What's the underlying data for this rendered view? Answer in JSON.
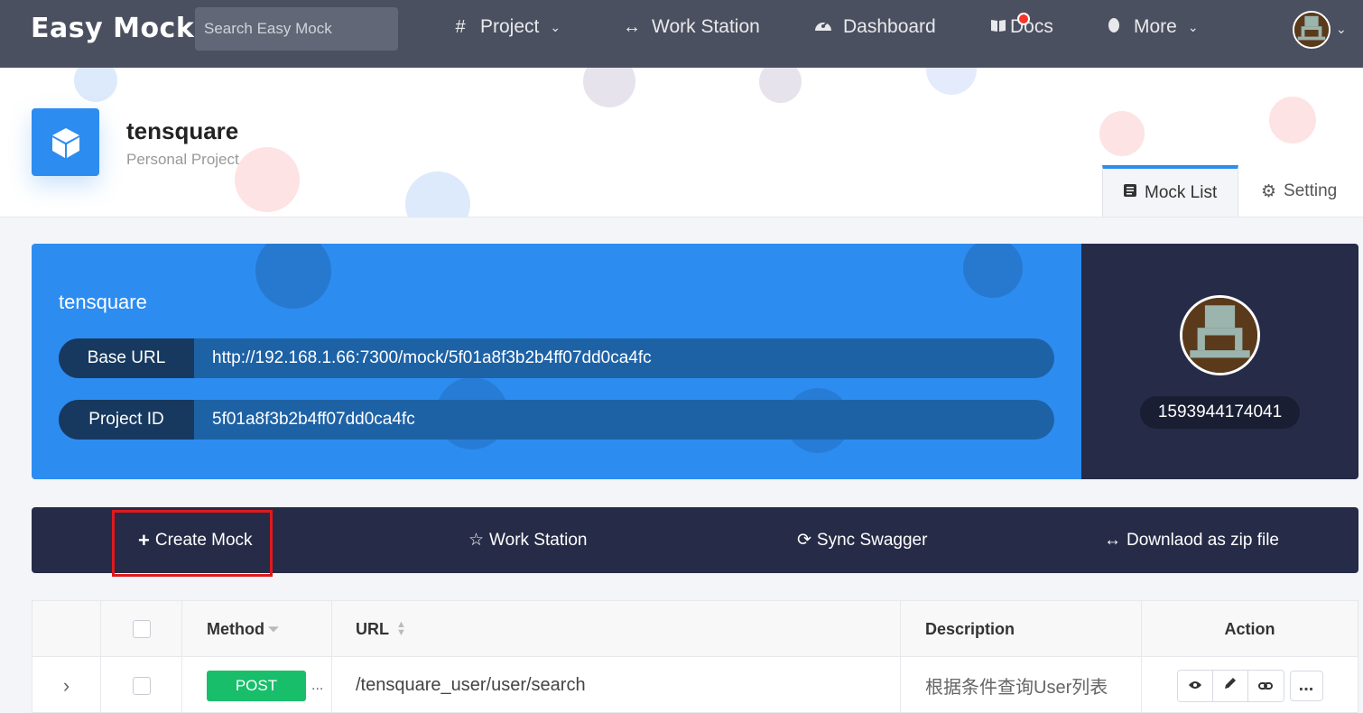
{
  "nav": {
    "logo": "Easy Mock",
    "search_placeholder": "Search Easy Mock",
    "items": [
      {
        "label": "Project",
        "icon": "hash-icon",
        "has_dropdown": true
      },
      {
        "label": "Work Station",
        "icon": "code-icon",
        "has_dropdown": false
      },
      {
        "label": "Dashboard",
        "icon": "dashboard-icon",
        "has_dropdown": false
      },
      {
        "label": "Docs",
        "icon": "book-icon",
        "has_dropdown": false,
        "notification_dot": true
      },
      {
        "label": "More",
        "icon": "drop-icon",
        "has_dropdown": true
      }
    ]
  },
  "project": {
    "name": "tensquare",
    "type": "Personal Project",
    "tabs": [
      {
        "label": "Mock List",
        "icon": "list-icon",
        "active": true
      },
      {
        "label": "Setting",
        "icon": "gear-icon",
        "active": false
      }
    ]
  },
  "info": {
    "title": "tensquare",
    "base_url_label": "Base URL",
    "base_url": "http://192.168.1.66:7300/mock/5f01a8f3b2b4ff07dd0ca4fc",
    "project_id_label": "Project ID",
    "project_id": "5f01a8f3b2b4ff07dd0ca4fc",
    "user_id": "1593944174041"
  },
  "toolbar": {
    "create": "Create Mock",
    "workstation": "Work Station",
    "sync": "Sync Swagger",
    "download": "Downlaod as zip file"
  },
  "table": {
    "headers": {
      "method": "Method",
      "url": "URL",
      "description": "Description",
      "action": "Action"
    },
    "rows": [
      {
        "method": "POST",
        "method_suffix": "...",
        "url": "/tensquare_user/user/search",
        "description": "根据条件查询User列表",
        "more": "..."
      }
    ]
  },
  "colors": {
    "nav_bg": "#4b5060",
    "primary": "#2d8cf0",
    "dark": "#262b47",
    "post": "#19be6b",
    "highlight": "#e0191c"
  }
}
